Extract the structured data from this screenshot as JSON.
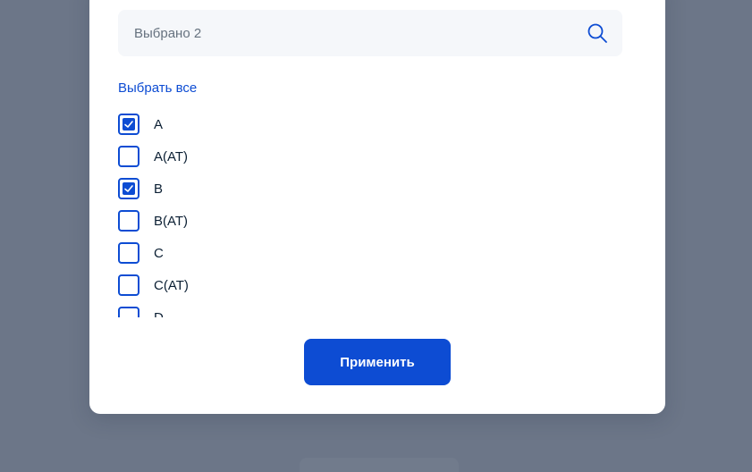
{
  "search": {
    "placeholder": "Выбрано 2",
    "value": ""
  },
  "select_all_label": "Выбрать все",
  "options": [
    {
      "label": "A",
      "checked": true
    },
    {
      "label": "A(AT)",
      "checked": false
    },
    {
      "label": "B",
      "checked": true
    },
    {
      "label": "B(AT)",
      "checked": false
    },
    {
      "label": "C",
      "checked": false
    },
    {
      "label": "C(AT)",
      "checked": false
    },
    {
      "label": "D",
      "checked": false
    }
  ],
  "apply_label": "Применить",
  "colors": {
    "accent": "#0d4cd3",
    "backdrop": "#6c7688",
    "text": "#0b1f33",
    "muted": "#66727f"
  }
}
